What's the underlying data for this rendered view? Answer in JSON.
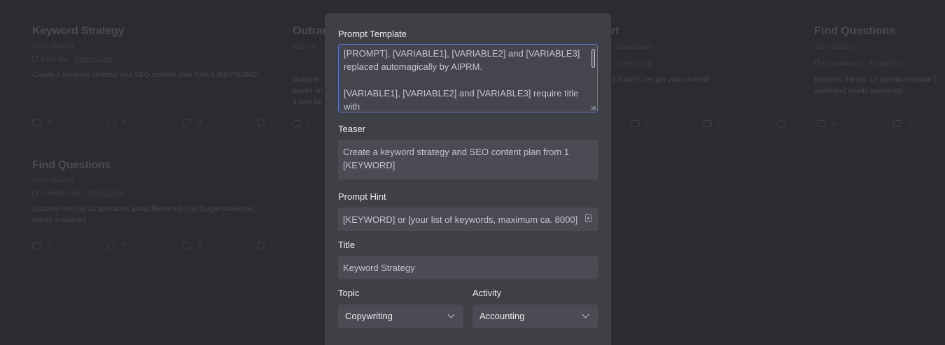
{
  "background_cards": [
    {
      "title": "Keyword Strategy",
      "category": "SEO / Ideation",
      "time": "1 day ago",
      "forked": "Forked From",
      "description": "Create a keyword strategy and SEO content plan from 1 [KEYWORD]",
      "stats": [
        "0",
        "0",
        "0"
      ]
    },
    {
      "title": "Find Questions",
      "category": "SEO / Ideation",
      "time": "6 minutes ago",
      "forked": "Forked From",
      "description": "Discover the top 10 questions about [keyword] that [target audience] needs answered.",
      "stats": [
        "0",
        "0",
        "0"
      ]
    }
  ],
  "clipped_cards": {
    "outrank_title": "Outran",
    "outrank_cat": "SEO / W",
    "outrank_desc_1": "Outrank",
    "outrank_desc_2": "based on",
    "outrank_desc_3": "a little be",
    "sheet_title": "rt",
    "sheet_cat": "/ Spreadsheets",
    "sheet_forked": "Forked From",
    "sheet_desc": "S Excel? I've got you covered!",
    "right_title": "Find Questions",
    "right_cat": "SEO / Ideation",
    "right_time": "6 minutes ago",
    "right_forked": "Forked From",
    "right_desc_1": "Discover the top 10 questions about [",
    "right_desc_2": "audience] needs answered.",
    "stat_zero": "0"
  },
  "modal": {
    "prompt_template_label": "Prompt Template",
    "prompt_template_value": "[PROMPT], [VARIABLE1], [VARIABLE2] and [VARIABLE3]\nreplaced automagically by AIPRM.\n\n[VARIABLE1], [VARIABLE2] and [VARIABLE3] require title with\noptional default value and available values.",
    "teaser_label": "Teaser",
    "teaser_value": "Create a keyword strategy and SEO content plan from 1\n[KEYWORD]",
    "prompt_hint_label": "Prompt Hint",
    "prompt_hint_value": "[KEYWORD] or [your list of keywords, maximum ca. 8000]",
    "title_label": "Title",
    "title_value": "Keyword Strategy",
    "topic_label": "Topic",
    "topic_value": "Copywriting",
    "activity_label": "Activity",
    "activity_value": "Accounting"
  },
  "colors": {
    "backdrop": "#2b2c2f",
    "modal_bg": "#3f4046",
    "focus_border": "#5b73c9"
  }
}
